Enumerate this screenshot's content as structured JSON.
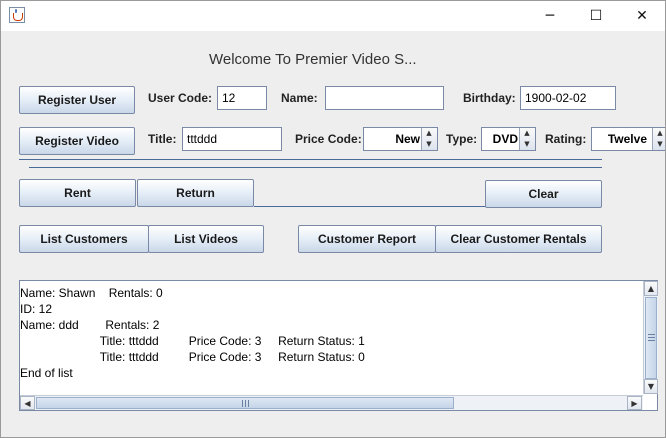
{
  "window": {
    "title": "",
    "icon": "java-cup-icon",
    "minimize_glyph": "─",
    "maximize_glyph": "☐",
    "close_glyph": "✕"
  },
  "header": {
    "welcome": "Welcome To Premier Video S..."
  },
  "user_row": {
    "register_user_label": "Register User",
    "user_code_label": "User Code:",
    "user_code_value": "12",
    "name_label": "Name:",
    "name_value": "",
    "birthday_label": "Birthday:",
    "birthday_value": "1900-02-02"
  },
  "video_row": {
    "register_video_label": "Register Video",
    "title_label": "Title:",
    "title_value": "tttddd",
    "price_code_label": "Price Code:",
    "price_code_value": "New",
    "type_label": "Type:",
    "type_value": "DVD",
    "rating_label": "Rating:",
    "rating_value": "Twelve"
  },
  "actions": {
    "rent_label": "Rent",
    "return_label": "Return",
    "clear_label": "Clear",
    "list_customers_label": "List Customers",
    "list_videos_label": "List Videos",
    "customer_report_label": "Customer Report",
    "clear_customer_rentals_label": "Clear Customer Rentals"
  },
  "output": {
    "lines": [
      "Name: Shawn    Rentals: 0",
      "ID: 12",
      "Name: ddd        Rentals: 2",
      "                        Title: tttddd         Price Code: 3     Return Status: 1",
      "                        Title: tttddd         Price Code: 3     Return Status: 0",
      "End of list"
    ]
  },
  "colors": {
    "background": "#eeeeee",
    "button_border": "#7a8aa6",
    "separator": "#4a6a9a"
  }
}
